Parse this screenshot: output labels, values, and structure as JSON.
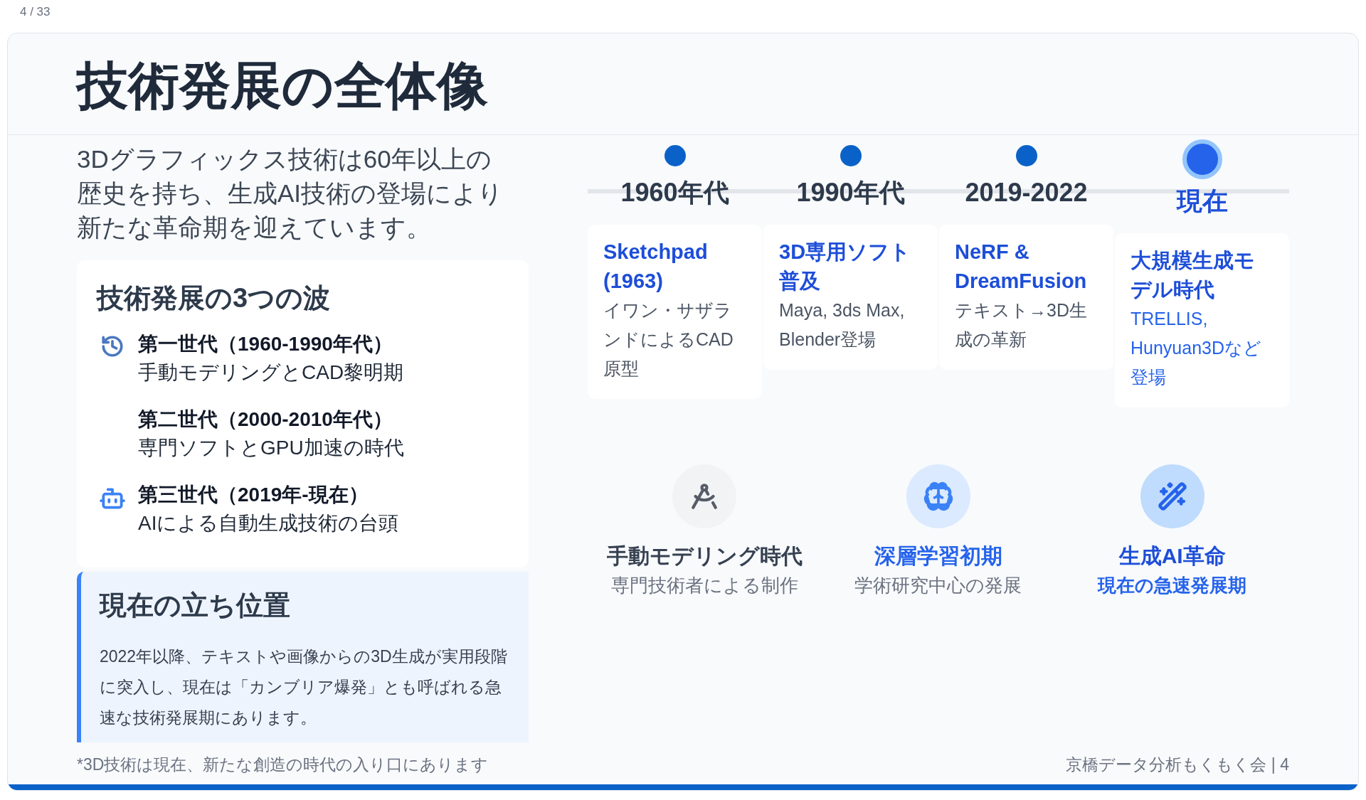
{
  "page_counter": "4 / 33",
  "slide": {
    "title": "技術発展の全体像",
    "intro": "3Dグラフィックス技術は60年以上の歴史を持ち、生成AI技術の登場により新たな革命期を迎えています。",
    "waves": {
      "heading": "技術発展の3つの波",
      "items": [
        {
          "title": "第一世代（1960-1990年代）",
          "text": "手動モデリングとCAD黎明期"
        },
        {
          "title": "第二世代（2000-2010年代）",
          "text": "専門ソフトとGPU加速の時代"
        },
        {
          "title": "第三世代（2019年-現在）",
          "text": "AIによる自動生成技術の台頭"
        }
      ]
    },
    "position": {
      "heading": "現在の立ち位置",
      "text": "2022年以降、テキストや画像からの3D生成が実用段階に突入し、現在は「カンブリア爆発」とも呼ばれる急速な技術発展期にあります。"
    },
    "timeline": [
      {
        "year": "1960年代",
        "current": false,
        "title": "Sketchpad (1963)",
        "text": "イワン・サザランドによるCAD原型"
      },
      {
        "year": "1990年代",
        "current": false,
        "title": "3D専用ソフト普及",
        "text": "Maya, 3ds Max, Blender登場"
      },
      {
        "year": "2019-2022",
        "current": false,
        "title": "NeRF & DreamFusion",
        "text": "テキスト→3D生成の革新"
      },
      {
        "year": "現在",
        "current": true,
        "title": "大規模生成モデル時代",
        "text": "TRELLIS, Hunyuan3Dなど登場"
      }
    ],
    "eras": [
      {
        "kind": "manual",
        "title": "手動モデリング時代",
        "text": "専門技術者による制作"
      },
      {
        "kind": "deep",
        "title": "深層学習初期",
        "text": "学術研究中心の発展"
      },
      {
        "kind": "generative",
        "title": "生成AI革命",
        "text": "現在の急速発展期"
      }
    ],
    "footnote": "*3D技術は現在、新たな創造の時代の入り口にあります",
    "footer": "京橋データ分析もくもく会 | 4"
  }
}
